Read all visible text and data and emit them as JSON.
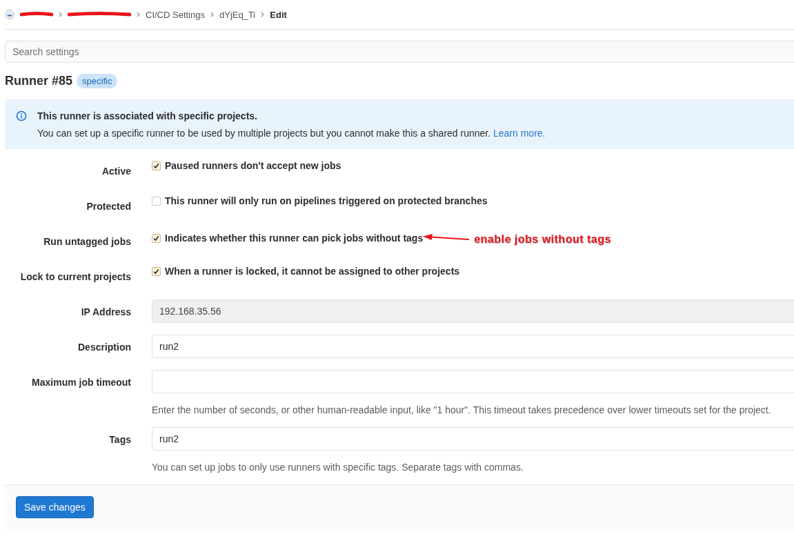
{
  "breadcrumb": [
    {
      "kind": "redacted"
    },
    {
      "kind": "redacted"
    },
    {
      "kind": "link",
      "text": "CI/CD Settings"
    },
    {
      "kind": "link",
      "text": "dYjEq_Ti"
    },
    {
      "kind": "current",
      "text": "Edit"
    }
  ],
  "search": {
    "placeholder": "Search settings"
  },
  "title": "Runner #85",
  "badge": "specific",
  "alert": {
    "title": "This runner is associated with specific projects.",
    "body": "You can set up a specific runner to be used by multiple projects but you cannot make this a shared runner.",
    "link": "Learn more."
  },
  "fields": [
    {
      "kind": "checkbox",
      "label": "Active",
      "text": "Paused runners don't accept new jobs",
      "checked": true
    },
    {
      "kind": "checkbox",
      "label": "Protected",
      "text": "This runner will only run on pipelines triggered on protected branches",
      "checked": false
    },
    {
      "kind": "checkbox",
      "label": "Run untagged jobs",
      "text": "Indicates whether this runner can pick jobs without tags",
      "checked": true,
      "annotation": "enable jobs without tags"
    },
    {
      "kind": "checkbox",
      "label": "Lock to current projects",
      "text": "When a runner is locked, it cannot be assigned to other projects",
      "checked": true
    },
    {
      "kind": "input",
      "label": "IP Address",
      "value": "192.168.35.56",
      "readonly": true
    },
    {
      "kind": "input",
      "label": "Description",
      "value": "run2",
      "readonly": false
    },
    {
      "kind": "input",
      "label": "Maximum job timeout",
      "readonly": false,
      "help": "Enter the number of seconds, or other human-readable input, like \"1 hour\". This timeout takes precedence over lower timeouts set for the project."
    },
    {
      "kind": "input",
      "label": "Tags",
      "value": "run2",
      "readonly": false,
      "help": "You can set up jobs to only use runners with specific tags. Separate tags with commas."
    }
  ],
  "save_button": "Save changes"
}
